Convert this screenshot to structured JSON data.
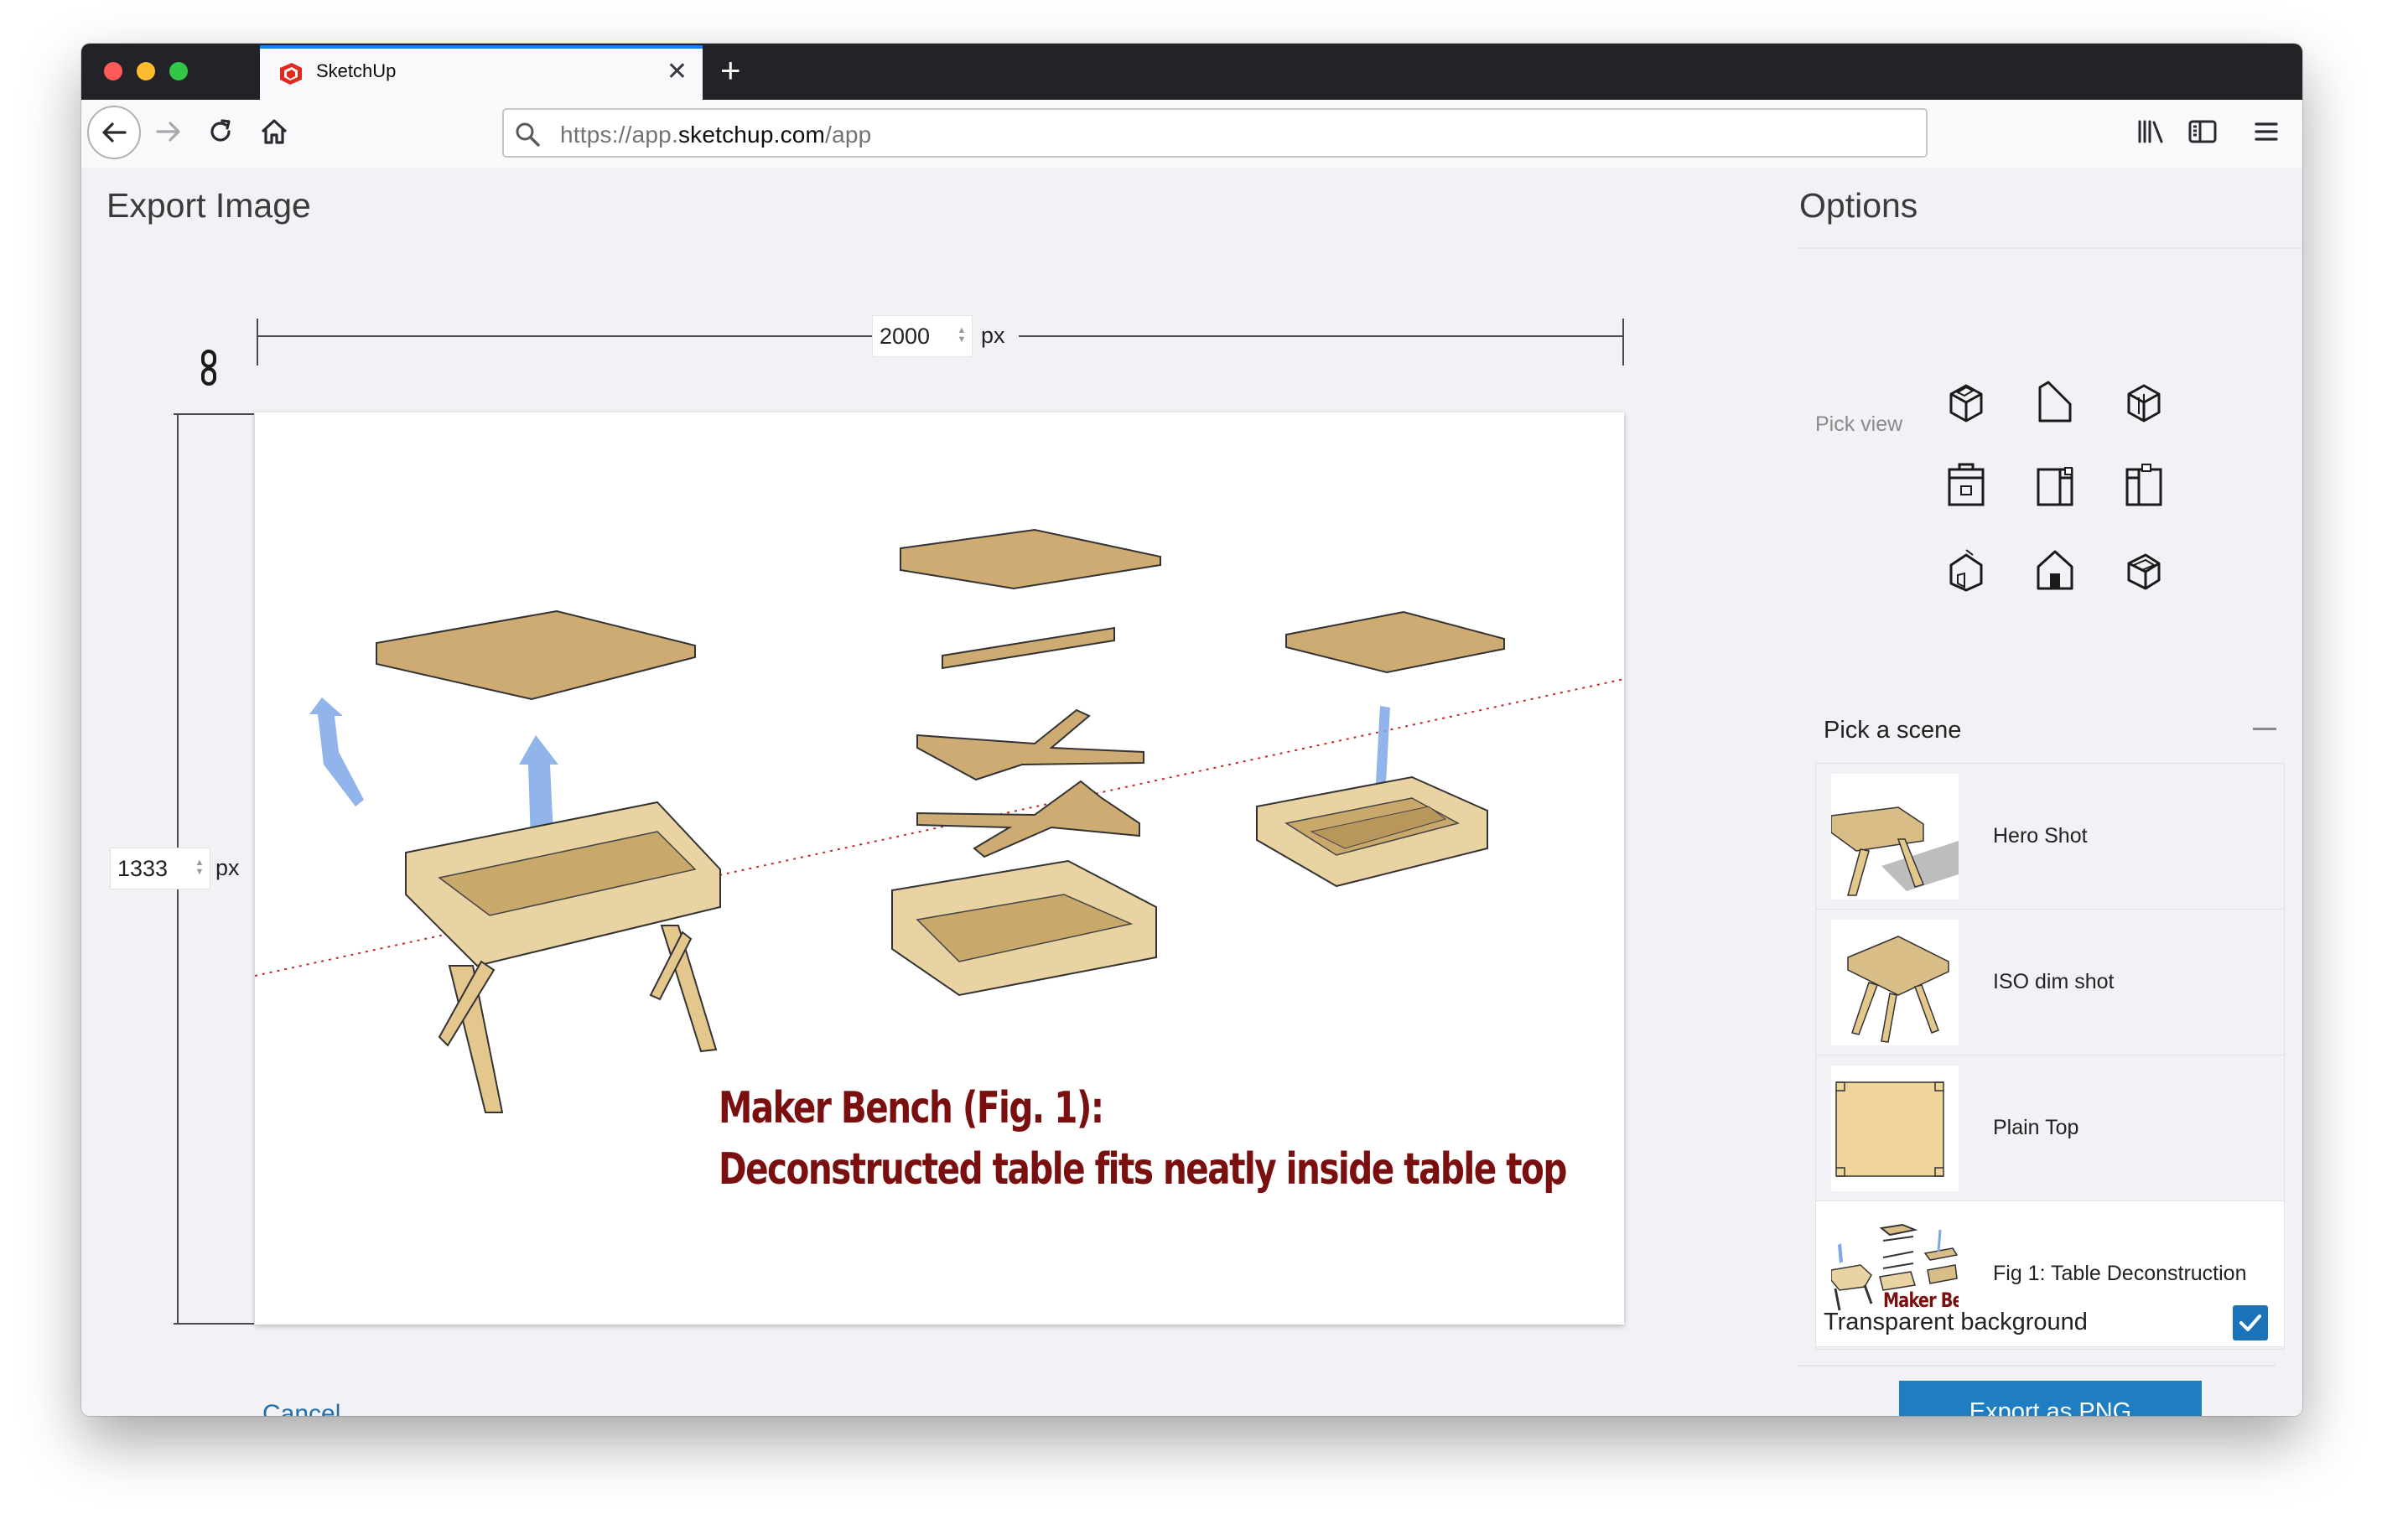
{
  "browser": {
    "tab_title": "SketchUp",
    "url_prefix": "https://app.",
    "url_domain": "sketchup.com",
    "url_path": "/app",
    "icons": [
      "back-icon",
      "forward-icon",
      "reload-icon",
      "home-icon",
      "search-icon",
      "library-icon",
      "sidebar-icon",
      "menu-icon"
    ]
  },
  "export": {
    "title": "Export Image",
    "width_value": "2000",
    "height_value": "1333",
    "unit": "px",
    "cancel_label": "Cancel"
  },
  "canvas": {
    "caption_line1": "Maker Bench (Fig. 1):",
    "caption_line2": "Deconstructed table fits neatly inside table top"
  },
  "options": {
    "title": "Options",
    "pick_view_label": "Pick view",
    "views": [
      "iso-view-icon",
      "top-view-icon",
      "front-view-icon",
      "right-view-icon",
      "back-view-icon",
      "left-view-icon",
      "bottom-view-icon",
      "perspective-view-icon",
      "axon-view-icon"
    ],
    "pick_scene_label": "Pick a scene",
    "scenes": [
      {
        "name": "Hero Shot",
        "thumb_text": ""
      },
      {
        "name": "ISO dim shot",
        "thumb_text": ""
      },
      {
        "name": "Plain Top",
        "thumb_text": ""
      },
      {
        "name": "Fig 1: Table Deconstruction",
        "thumb_text": "Maker Be"
      }
    ],
    "transparent_label": "Transparent background",
    "transparent_checked": true,
    "export_label": "Export as PNG"
  },
  "colors": {
    "accent": "#1f7ec2",
    "caption": "#7a0f0f",
    "wood": "#d8b77a"
  }
}
